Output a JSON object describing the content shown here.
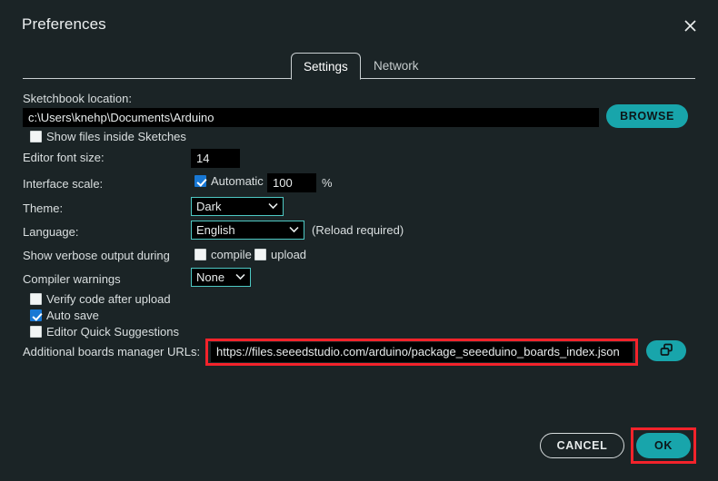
{
  "window": {
    "title": "Preferences",
    "close_icon": "close-icon"
  },
  "tabs": [
    {
      "label": "Settings",
      "active": true
    },
    {
      "label": "Network",
      "active": false
    }
  ],
  "settings": {
    "sketchbook": {
      "label": "Sketchbook location:",
      "value": "c:\\Users\\knehp\\Documents\\Arduino",
      "browse_label": "BROWSE"
    },
    "show_files_inside_sketches": {
      "label": "Show files inside Sketches",
      "checked": false
    },
    "editor_font_size": {
      "label": "Editor font size:",
      "value": "14"
    },
    "interface_scale": {
      "label": "Interface scale:",
      "automatic_label": "Automatic",
      "automatic_checked": true,
      "value": "100",
      "unit": "%"
    },
    "theme": {
      "label": "Theme:",
      "value": "Dark",
      "options": [
        "Dark"
      ]
    },
    "language": {
      "label": "Language:",
      "value": "English",
      "options": [
        "English"
      ],
      "note": "(Reload required)"
    },
    "verbose_output": {
      "label": "Show verbose output during",
      "compile_label": "compile",
      "compile_checked": false,
      "upload_label": "upload",
      "upload_checked": false
    },
    "compiler_warnings": {
      "label": "Compiler warnings",
      "value": "None",
      "options": [
        "None"
      ]
    },
    "verify_code_after_upload": {
      "label": "Verify code after upload",
      "checked": false
    },
    "auto_save": {
      "label": "Auto save",
      "checked": true
    },
    "editor_quick_suggestions": {
      "label": "Editor Quick Suggestions",
      "checked": false
    },
    "additional_urls": {
      "label": "Additional boards manager URLs:",
      "value": "https://files.seeedstudio.com/arduino/package_seeeduino_boards_index.json",
      "expand_icon": "open-window-icon"
    }
  },
  "footer": {
    "cancel_label": "CANCEL",
    "ok_label": "OK"
  },
  "colors": {
    "dialog_bg": "#1b2426",
    "field_bg": "#000000",
    "accent_teal": "#18a5ab",
    "select_border": "#4ec9c4",
    "checkbox_checked": "#1878d4",
    "highlight_red": "#f3232b",
    "text": "#dadfe0"
  }
}
